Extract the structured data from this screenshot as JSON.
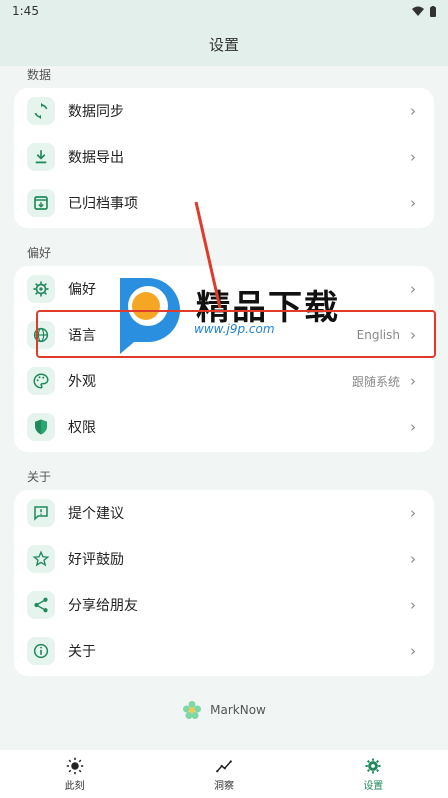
{
  "status": {
    "time": "1:45"
  },
  "app_bar": {
    "title": "设置"
  },
  "sections": [
    {
      "title": "数据",
      "items": [
        {
          "label": "数据同步",
          "value": "",
          "icon": "sync-icon"
        },
        {
          "label": "数据导出",
          "value": "",
          "icon": "download-icon"
        },
        {
          "label": "已归档事项",
          "value": "",
          "icon": "archive-icon"
        }
      ]
    },
    {
      "title": "偏好",
      "items": [
        {
          "label": "偏好",
          "value": "",
          "icon": "gear-icon"
        },
        {
          "label": "语言",
          "value": "English",
          "icon": "globe-icon"
        },
        {
          "label": "外观",
          "value": "跟随系统",
          "icon": "palette-icon"
        },
        {
          "label": "权限",
          "value": "",
          "icon": "shield-icon"
        }
      ]
    },
    {
      "title": "关于",
      "items": [
        {
          "label": "提个建议",
          "value": "",
          "icon": "feedback-icon"
        },
        {
          "label": "好评鼓励",
          "value": "",
          "icon": "star-icon"
        },
        {
          "label": "分享给朋友",
          "value": "",
          "icon": "share-icon"
        },
        {
          "label": "关于",
          "value": "",
          "icon": "info-icon"
        }
      ]
    }
  ],
  "footer": {
    "brand": "MarkNow"
  },
  "bottom_nav": [
    {
      "label": "此刻",
      "icon": "sun-icon"
    },
    {
      "label": "洞察",
      "icon": "trend-icon"
    },
    {
      "label": "设置",
      "icon": "gear-icon"
    }
  ],
  "watermark": {
    "title": "精品下载",
    "url": "www.j9p.com"
  },
  "colors": {
    "accent": "#1f8a5c",
    "icon_bg": "#e6f4ee",
    "highlight": "#e03b2a"
  }
}
